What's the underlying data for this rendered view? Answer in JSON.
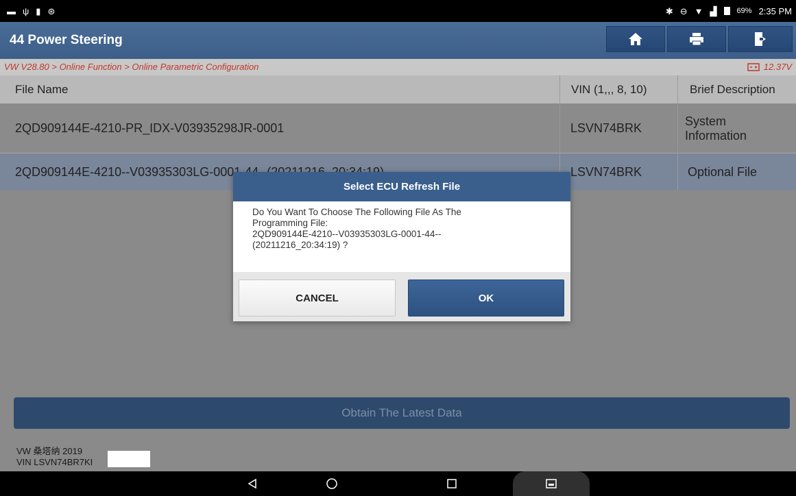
{
  "status_bar": {
    "battery_percent": "69%",
    "time": "2:35 PM",
    "left_icons": [
      "screenshot-icon",
      "usb-icon",
      "sd-card-icon",
      "app-icon"
    ],
    "right_icons": [
      "bluetooth-icon",
      "dnd-icon",
      "wifi-icon",
      "signal-icon",
      "battery-icon"
    ]
  },
  "header": {
    "title": "44 Power Steering",
    "buttons": [
      "home-icon",
      "print-icon",
      "exit-icon"
    ]
  },
  "breadcrumb": {
    "path": "VW V28.80 > Online Function > Online Parametric Configuration",
    "voltage": "12.37V"
  },
  "table": {
    "columns": [
      "File Name",
      "VIN (1,,, 8, 10)",
      "Brief Description"
    ],
    "rows": [
      {
        "file": "2QD909144E-4210-PR_IDX-V03935298JR-0001",
        "vin": "LSVN74BRK",
        "desc_line1": "System",
        "desc_line2": "Information"
      },
      {
        "file": "2QD909144E-4210--V03935303LG-0001-44--(20211216_20:34:19)",
        "vin": "LSVN74BRK",
        "desc_line1": "Optional File",
        "desc_line2": ""
      }
    ]
  },
  "obtain_button": "Obtain The Latest Data",
  "vehicle": {
    "model": "VW 桑塔纳 2019",
    "vin": "VIN LSVN74BR7KI"
  },
  "dialog": {
    "title": "Select ECU Refresh File",
    "message_line1": "Do You Want To Choose The Following File As The",
    "message_line2": "Programming File:",
    "message_line3": "2QD909144E-4210--V03935303LG-0001-44--",
    "message_line4": "(20211216_20:34:19) ?",
    "cancel_label": "CANCEL",
    "ok_label": "OK"
  },
  "colors": {
    "header_blue": "#3c5e88",
    "breadcrumb_red": "#c0392b",
    "ok_blue": "#2d5282"
  }
}
